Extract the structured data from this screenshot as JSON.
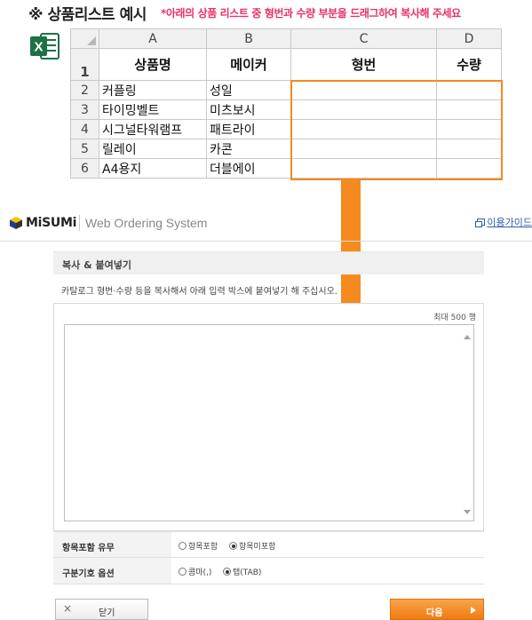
{
  "heading": {
    "title": "※ 상품리스트 예시",
    "note": "*아래의 상품 리스트 중 형번과 수량 부분을 드래그하여 복사해 주세요"
  },
  "icons": {
    "excel": "excel-icon",
    "arrow": "down-arrow-icon",
    "logo": "misumi-cube-icon"
  },
  "colors": {
    "accent": "#f58a1f",
    "note": "#e8336a",
    "link": "#2a5db0"
  },
  "sheet": {
    "columns": [
      "A",
      "B",
      "C",
      "D"
    ],
    "header_row_number": "1",
    "headers": [
      "상품명",
      "메이커",
      "형번",
      "수량"
    ],
    "rows": [
      {
        "num": "2",
        "a": "커플링",
        "b": "성일",
        "c": "",
        "d": ""
      },
      {
        "num": "3",
        "a": "타이밍벨트",
        "b": "미츠보시",
        "c": "",
        "d": ""
      },
      {
        "num": "4",
        "a": "시그널타워램프",
        "b": "패트라이",
        "c": "",
        "d": ""
      },
      {
        "num": "5",
        "a": "릴레이",
        "b": "카콘",
        "c": "",
        "d": ""
      },
      {
        "num": "6",
        "a": "A4용지",
        "b": "더블에이",
        "c": "",
        "d": ""
      }
    ]
  },
  "brand": {
    "name": "MiSUMi",
    "subtitle": "Web Ordering System",
    "guide_link": "이용가이드"
  },
  "paste": {
    "section_title": "복사 & 붙여넣기",
    "instruction": "카탈로그 형번·수량 등을 복사해서 아래 입력 박스에 붙여넣기 해 주십시오.",
    "max_rows": "최대 500 행",
    "textarea_value": ""
  },
  "options": {
    "header_option": {
      "label": "항목포함 유무",
      "choices": [
        "항목포함",
        "항목미포함"
      ],
      "selected": "항목미포함"
    },
    "delimiter_option": {
      "label": "구분기호 옵션",
      "choices": [
        "콤마(,)",
        "탭(TAB)"
      ],
      "selected": "탭(TAB)"
    }
  },
  "buttons": {
    "close": "닫기",
    "next": "다음"
  }
}
